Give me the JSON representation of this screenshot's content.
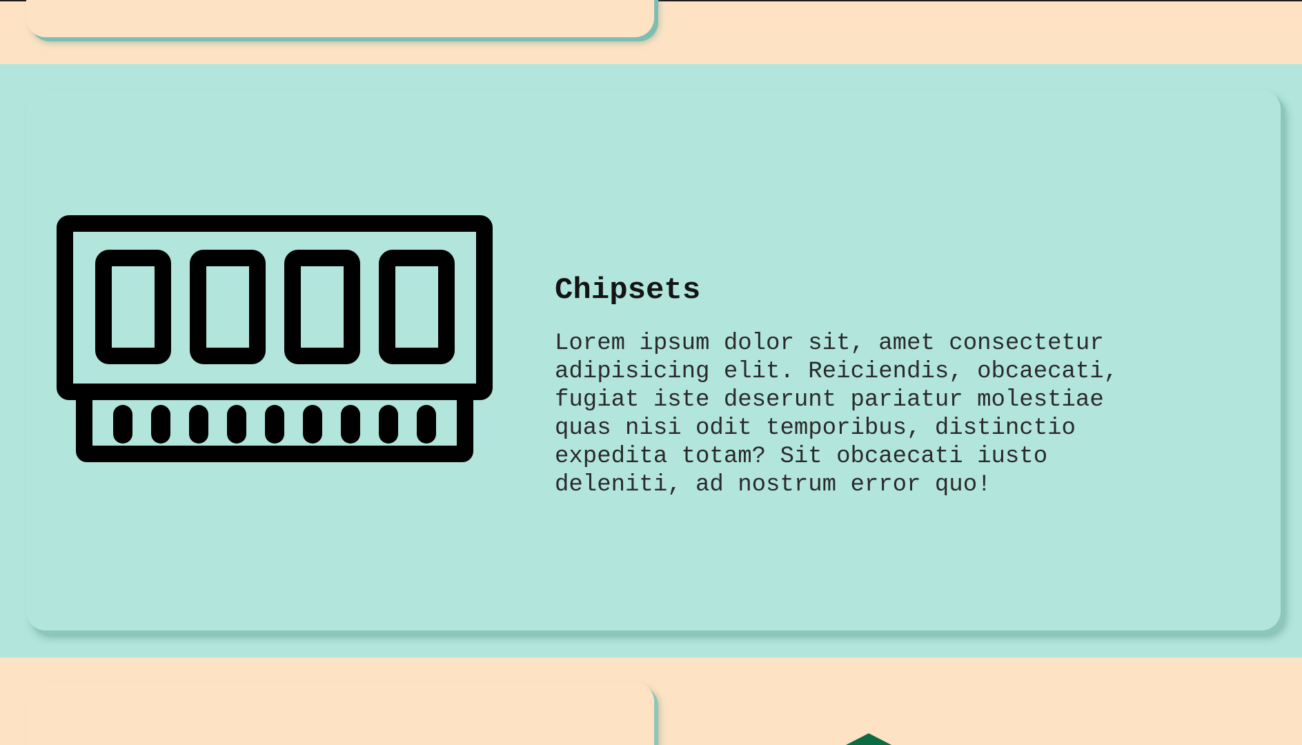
{
  "feature_card": {
    "title": "Chipsets",
    "description": "Lorem ipsum dolor sit, amet consectetur adipisicing elit. Reiciendis, obcaecati, fugiat iste deserunt pariatur molestiae quas nisi odit temporibus, distinctio expedita totam? Sit obcaecati iusto deleniti, ad nostrum error quo!",
    "icon": "memory-chip-icon"
  },
  "colors": {
    "peach_background": "#fde3c4",
    "mint_background": "#b2e6dd",
    "card_shadow": "#8cc6bc",
    "icon_color": "#000000",
    "accent_green": "#0d6b44"
  }
}
